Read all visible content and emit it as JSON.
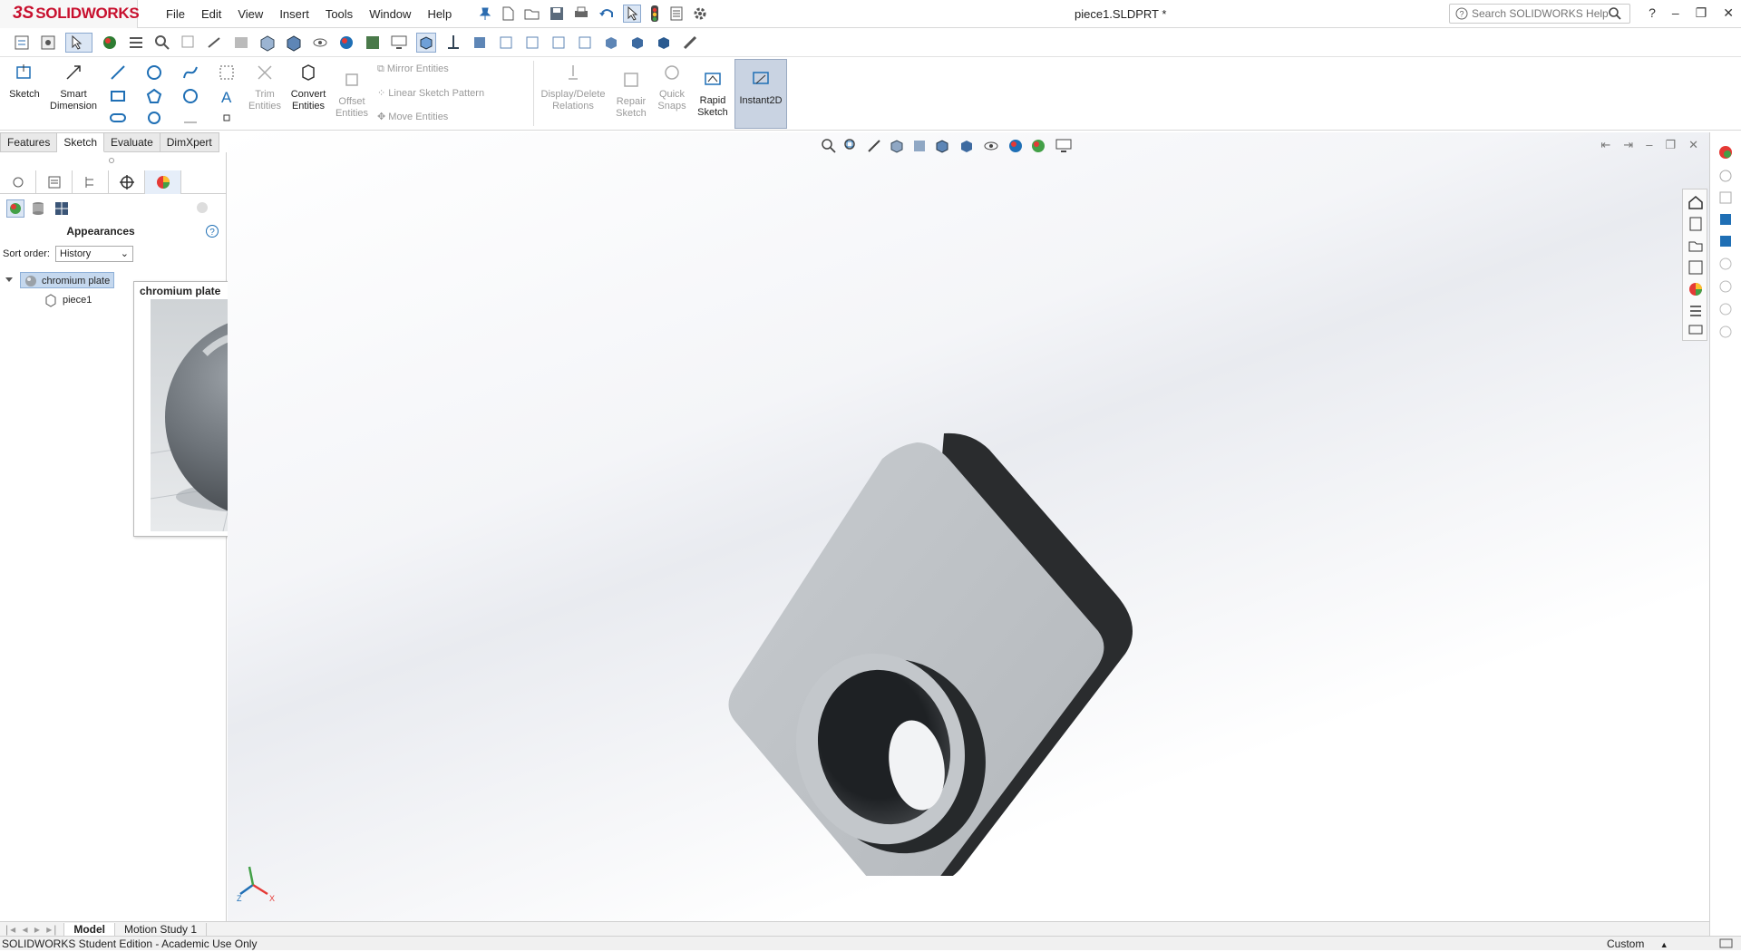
{
  "app": {
    "logo_ds": "3S",
    "logo_name": "SOLIDWORKS",
    "doc_title": "piece1.SLDPRT *"
  },
  "menu": [
    "File",
    "Edit",
    "View",
    "Insert",
    "Tools",
    "Window",
    "Help"
  ],
  "search": {
    "placeholder": "Search SOLIDWORKS Help"
  },
  "cmd": {
    "sketch": "Sketch",
    "smart_dim_1": "Smart",
    "smart_dim_2": "Dimension",
    "trim_1": "Trim",
    "trim_2": "Entities",
    "convert_1": "Convert",
    "convert_2": "Entities",
    "offset_1": "Offset",
    "offset_2": "Entities",
    "mirror": "Mirror Entities",
    "linear_pattern": "Linear Sketch Pattern",
    "move": "Move Entities",
    "display_rel_1": "Display/Delete",
    "display_rel_2": "Relations",
    "repair_1": "Repair",
    "repair_2": "Sketch",
    "quick_1": "Quick",
    "quick_2": "Snaps",
    "rapid_1": "Rapid",
    "rapid_2": "Sketch",
    "instant2d": "Instant2D"
  },
  "tabs": [
    "Features",
    "Sketch",
    "Evaluate",
    "DimXpert"
  ],
  "panel": {
    "title": "Appearances",
    "sort_label": "Sort order:",
    "sort_value": "History",
    "tree_item": "chromium plate",
    "tree_child": "piece1"
  },
  "tooltip": {
    "title": "chromium plate"
  },
  "bottom_tabs": [
    "Model",
    "Motion Study 1"
  ],
  "status": {
    "left": "SOLIDWORKS Student Edition - Academic Use Only",
    "right": "Custom"
  },
  "colors": {
    "brand": "#c8102e",
    "accent": "#1f6fb5",
    "part": "#b9bdc1"
  }
}
